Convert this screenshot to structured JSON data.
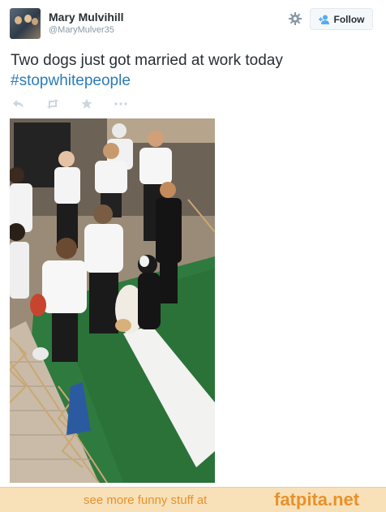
{
  "tweet": {
    "display_name": "Mary Mulvihill",
    "handle": "@MaryMulver35",
    "text_line1": "Two dogs just got married at work today",
    "hashtag": "#stopwhitepeople",
    "follow_label": "Follow"
  },
  "icons": {
    "settings": "gear-icon",
    "follow": "person-plus-icon",
    "reply": "reply-icon",
    "retweet": "retweet-icon",
    "favorite": "star-icon",
    "more": "more-icon"
  },
  "footer": {
    "prefix": "see more funny stuff at",
    "brand": "fatpita.net"
  },
  "colors": {
    "hashtag": "#2b7bb9",
    "action_icons": "#ccd6dd",
    "footer_bg": "#f8e1b8",
    "footer_text": "#e8912c"
  }
}
